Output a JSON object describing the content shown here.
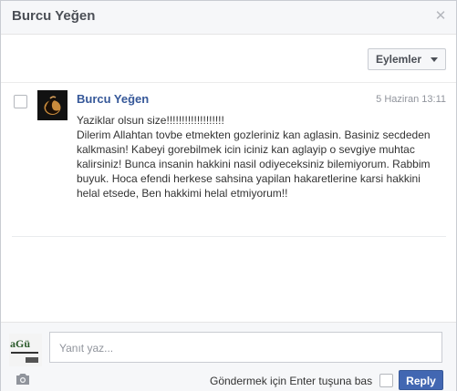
{
  "window": {
    "title": "Burcu Yeğen",
    "close_icon": "close-icon"
  },
  "toolbar": {
    "actions_label": "Eylemler"
  },
  "message": {
    "sender": "Burcu Yeğen",
    "timestamp": "5 Haziran 13:11",
    "line1": "Yaziklar olsun size!!!!!!!!!!!!!!!!!!!",
    "body": "Dilerim Allahtan tovbe etmekten gozleriniz kan aglasin. Basiniz secdeden kalkmasin! Kabeyi gorebilmek icin iciniz kan aglayip o sevgiye muhtac kalirsiniz! Bunca insanin hakkini nasil odiyeceksiniz bilemiyorum. Rabbim buyuk. Hoca efendi herkese sahsina yapilan hakaretlerine karsi hakkini helal etsede, Ben hakkimi helal etmiyorum!!"
  },
  "composer": {
    "placeholder": "Yanıt yaz...",
    "enter_to_send_label": "Göndermek için Enter tuşuna bas",
    "reply_label": "Reply"
  },
  "thumbnail": {
    "logo_text": "aGü"
  },
  "colors": {
    "link": "#365899",
    "primary_button": "#4267b2"
  }
}
